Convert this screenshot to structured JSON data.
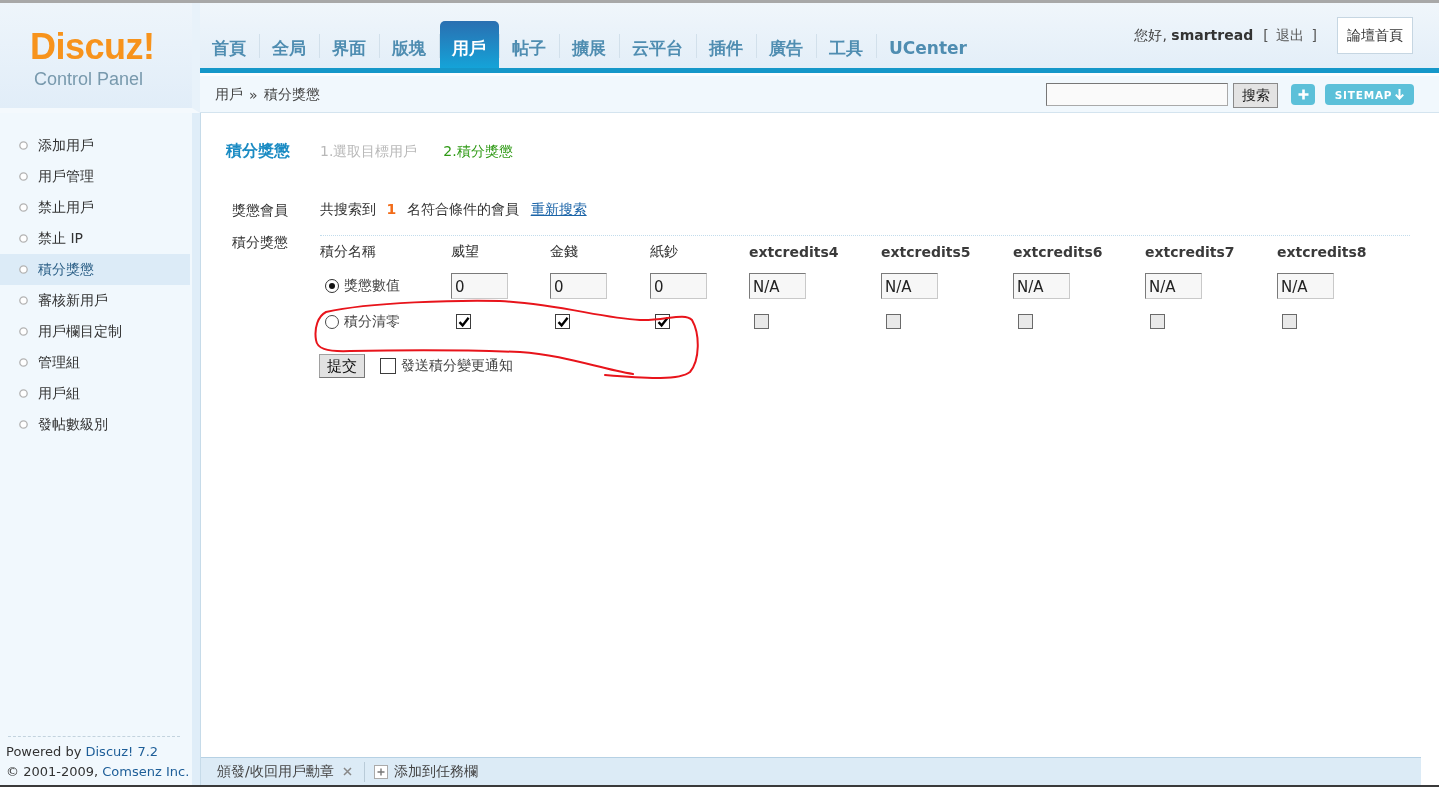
{
  "logo": {
    "title": "Discuz!",
    "subtitle": "Control Panel"
  },
  "nav": {
    "tabs": [
      {
        "label": "首頁",
        "selected": false
      },
      {
        "label": "全局",
        "selected": false
      },
      {
        "label": "界面",
        "selected": false
      },
      {
        "label": "版塊",
        "selected": false
      },
      {
        "label": "用戶",
        "selected": true
      },
      {
        "label": "帖子",
        "selected": false
      },
      {
        "label": "擴展",
        "selected": false
      },
      {
        "label": "云平台",
        "selected": false
      },
      {
        "label": "插件",
        "selected": false
      },
      {
        "label": "廣告",
        "selected": false
      },
      {
        "label": "工具",
        "selected": false
      },
      {
        "label": "UCenter",
        "selected": false
      }
    ]
  },
  "user": {
    "greeting": "您好, **smartread**",
    "logout": "[ 退出 ]",
    "home_button": "論壇首頁"
  },
  "breadcrumb": {
    "items": [
      "用戶",
      "積分獎懲"
    ],
    "separator": "»"
  },
  "search": {
    "button": "搜索"
  },
  "sitemap_button": "SITEMAP",
  "sidebar": {
    "items": [
      {
        "label": "添加用戶",
        "selected": false
      },
      {
        "label": "用戶管理",
        "selected": false
      },
      {
        "label": "禁止用戶",
        "selected": false
      },
      {
        "label": "禁止 IP",
        "selected": false
      },
      {
        "label": "積分獎懲",
        "selected": true
      },
      {
        "label": "審核新用戶",
        "selected": false
      },
      {
        "label": "用戶欄目定制",
        "selected": false
      },
      {
        "label": "管理組",
        "selected": false
      },
      {
        "label": "用戶組",
        "selected": false
      },
      {
        "label": "發帖數級別",
        "selected": false
      }
    ]
  },
  "footer": [
    {
      "text": "Powered by",
      "link": "Discuz! 7.2"
    },
    {
      "text": "© 2001-2009,",
      "link": "Comsenz Inc."
    }
  ],
  "page": {
    "title": "積分獎懲",
    "steps": [
      {
        "label": "1.選取目標用戶",
        "selected": false
      },
      {
        "label": "2.積分獎懲",
        "selected": true
      }
    ]
  },
  "form": {
    "member_label": "獎懲會員",
    "member_text": "共搜索到 **1** 名符合條件的會員",
    "research_link": "重新搜索",
    "credits_label": "積分獎懲"
  },
  "credits_table": {
    "label_header": "積分名稱",
    "columns": [
      {
        "label": "威望",
        "bold": false
      },
      {
        "label": "金錢",
        "bold": false
      },
      {
        "label": "紙鈔",
        "bold": false
      },
      {
        "label": "extcredits4",
        "bold": true
      },
      {
        "label": "extcredits5",
        "bold": true
      },
      {
        "label": "extcredits6",
        "bold": true
      },
      {
        "label": "extcredits7",
        "bold": true
      },
      {
        "label": "extcredits8",
        "bold": true
      }
    ],
    "rows": [
      {
        "kind": "values",
        "label": "獎懲數值",
        "selected": true,
        "cells": [
          "0",
          "0",
          "0",
          "N/A",
          "N/A",
          "N/A",
          "N/A",
          "N/A"
        ]
      },
      {
        "kind": "reset",
        "label": "積分清零",
        "selected": false,
        "cells": [
          {
            "checked": true,
            "disabled": false
          },
          {
            "checked": true,
            "disabled": false
          },
          {
            "checked": true,
            "disabled": false
          },
          {
            "checked": false,
            "disabled": true
          },
          {
            "checked": false,
            "disabled": true
          },
          {
            "checked": false,
            "disabled": true
          },
          {
            "checked": false,
            "disabled": true
          },
          {
            "checked": false,
            "disabled": true
          }
        ]
      }
    ]
  },
  "submit": {
    "button": "提交",
    "notify": {
      "label": "發送積分變更通知",
      "checked": false
    }
  },
  "annotation": {
    "kind": "freehand-loop"
  },
  "taskbar": {
    "tabs": [
      {
        "label": "頒發/收回用戶勳章"
      }
    ],
    "add_label": "添加到任務欄"
  }
}
